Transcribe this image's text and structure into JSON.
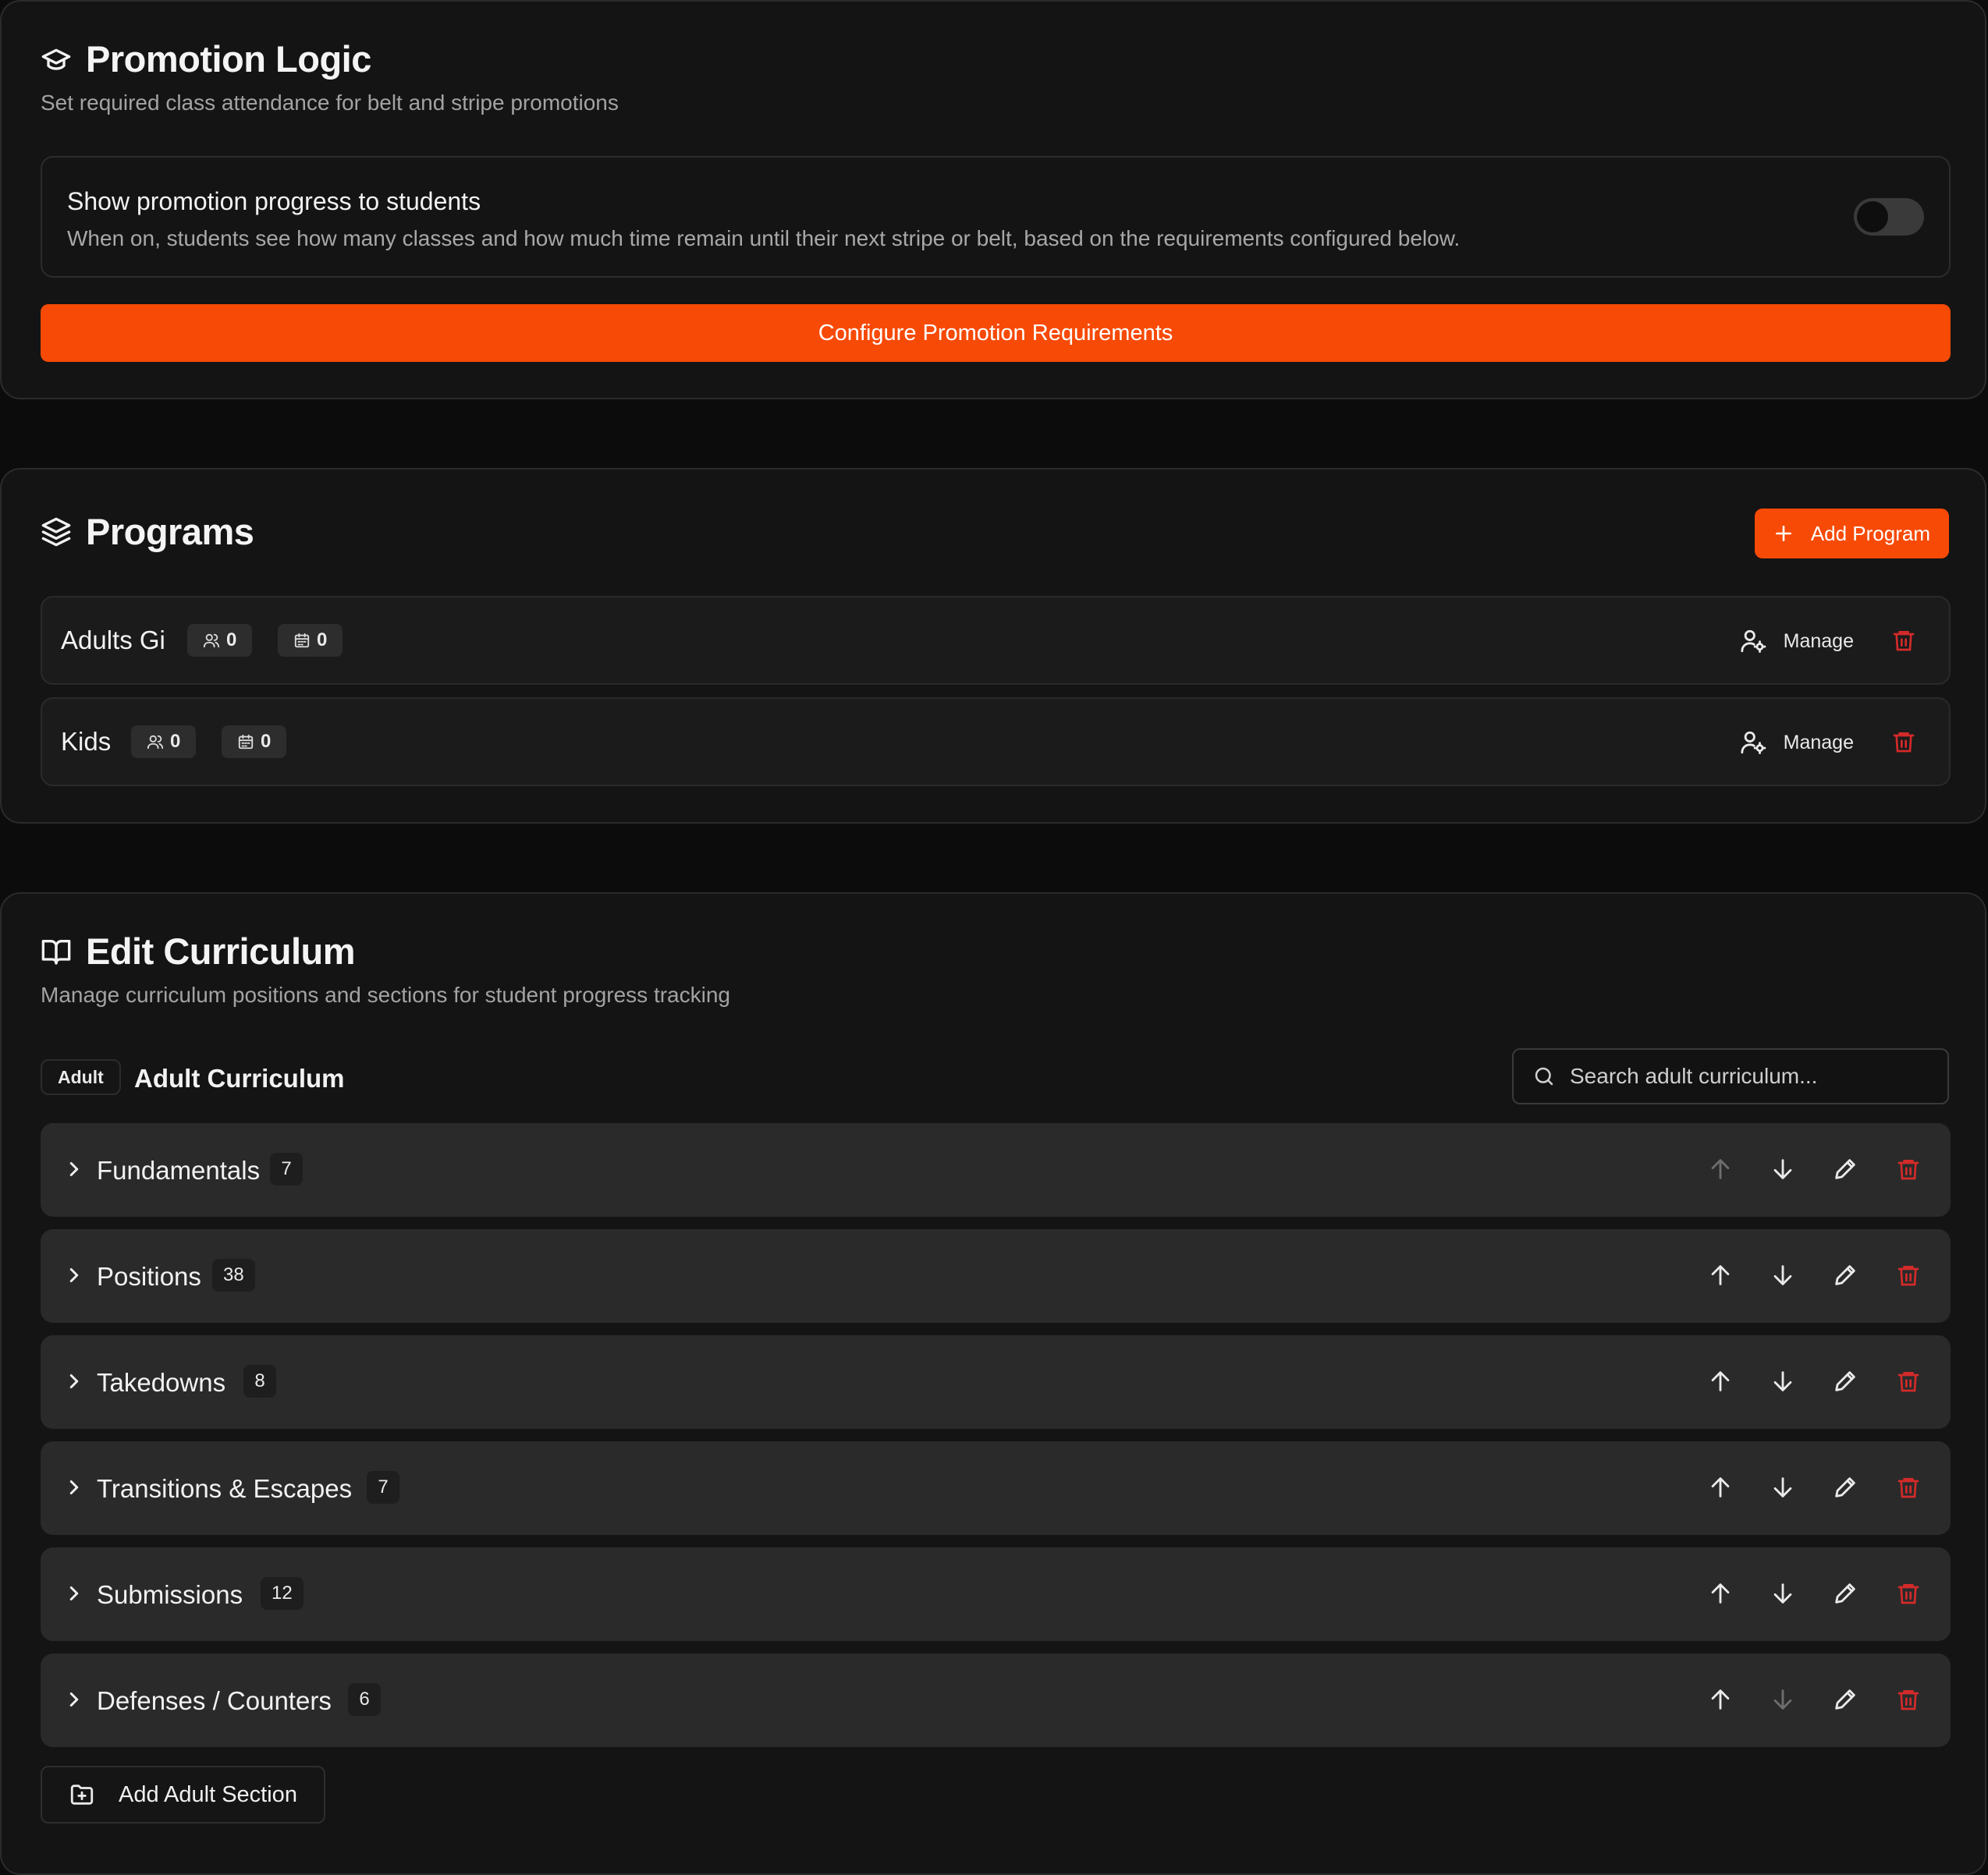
{
  "promotion": {
    "title": "Promotion Logic",
    "subtitle": "Set required class attendance for belt and stripe promotions",
    "setting_title": "Show promotion progress to students",
    "setting_desc": "When on, students see how many classes and how much time remain until their next stripe or belt, based on the requirements configured below.",
    "toggle_on": false,
    "configure_label": "Configure Promotion Requirements"
  },
  "programs": {
    "title": "Programs",
    "add_label": "Add Program",
    "items": [
      {
        "name": "Adults Gi",
        "members": "0",
        "schedules": "0",
        "manage_label": "Manage"
      },
      {
        "name": "Kids",
        "members": "0",
        "schedules": "0",
        "manage_label": "Manage"
      }
    ]
  },
  "curriculum": {
    "title": "Edit Curriculum",
    "subtitle": "Manage curriculum positions and sections for student progress tracking",
    "badge": "Adult",
    "label": "Adult Curriculum",
    "search_placeholder": "Search adult curriculum...",
    "sections": [
      {
        "name": "Fundamentals",
        "count": "7"
      },
      {
        "name": "Positions",
        "count": "38"
      },
      {
        "name": "Takedowns",
        "count": "8"
      },
      {
        "name": "Transitions & Escapes",
        "count": "7"
      },
      {
        "name": "Submissions",
        "count": "12"
      },
      {
        "name": "Defenses / Counters",
        "count": "6"
      }
    ],
    "add_section_label": "Add Adult Section"
  },
  "colors": {
    "accent": "#f74a06",
    "danger": "#d42a2a",
    "background": "#141414",
    "row": "#2a2a2a"
  }
}
